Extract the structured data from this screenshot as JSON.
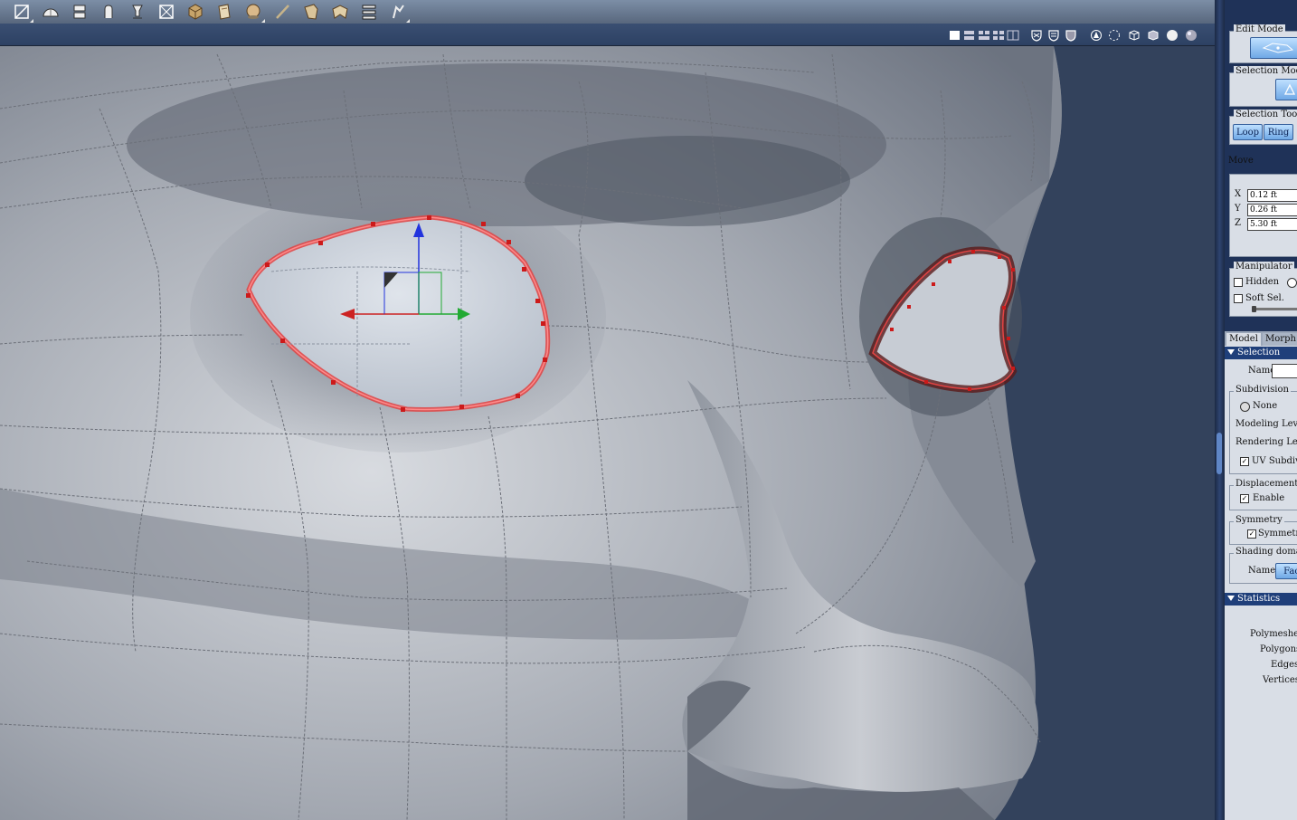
{
  "toolbar": {
    "tools": [
      "polygon-tool-icon",
      "dome-tool-icon",
      "extrude-tool-icon",
      "rotate-tool-icon",
      "stem-tool-icon",
      "crossbox-tool-icon",
      "cube-tool-icon",
      "sheet-tool-icon",
      "sphere-tool-icon",
      "knife-tool-icon",
      "bend-tool-icon",
      "twist-tool-icon",
      "align-tool-icon",
      "sweep-tool-icon"
    ]
  },
  "panel": {
    "edit_mode": {
      "label": "Edit Mode"
    },
    "selection_mode": {
      "label": "Selection Mode"
    },
    "selection_tools": {
      "label": "Selection Tools",
      "loop": "Loop",
      "ring": "Ring"
    },
    "move": {
      "label": "Move",
      "x_label": "X",
      "x_value": "0.12 ft",
      "y_label": "Y",
      "y_value": "0.26 ft",
      "z_label": "Z",
      "z_value": "5.30 ft"
    },
    "manipulator": {
      "label": "Manipulator",
      "hidden": "Hidden",
      "soft_sel": "Soft Sel."
    },
    "tabs": {
      "model": "Model",
      "morph": "Morph"
    },
    "selection_section": {
      "label": "Selection",
      "name_label": "Name"
    },
    "subdivision": {
      "label": "Subdivision",
      "none": "None",
      "modeling_level": "Modeling Level",
      "rendering_level": "Rendering Level",
      "uv_subdiv": "UV Subdivi"
    },
    "displacement": {
      "label": "Displacement",
      "enable": "Enable"
    },
    "symmetry": {
      "label": "Symmetry",
      "symmetry": "Symmetry"
    },
    "shading": {
      "label": "Shading domain",
      "name_label": "Name",
      "face_button": "Face"
    },
    "statistics": {
      "label": "Statistics",
      "polymeshes": "Polymeshes:",
      "polygons": "Polygons:",
      "edges": "Edges:",
      "vertices": "Vertices:"
    }
  }
}
